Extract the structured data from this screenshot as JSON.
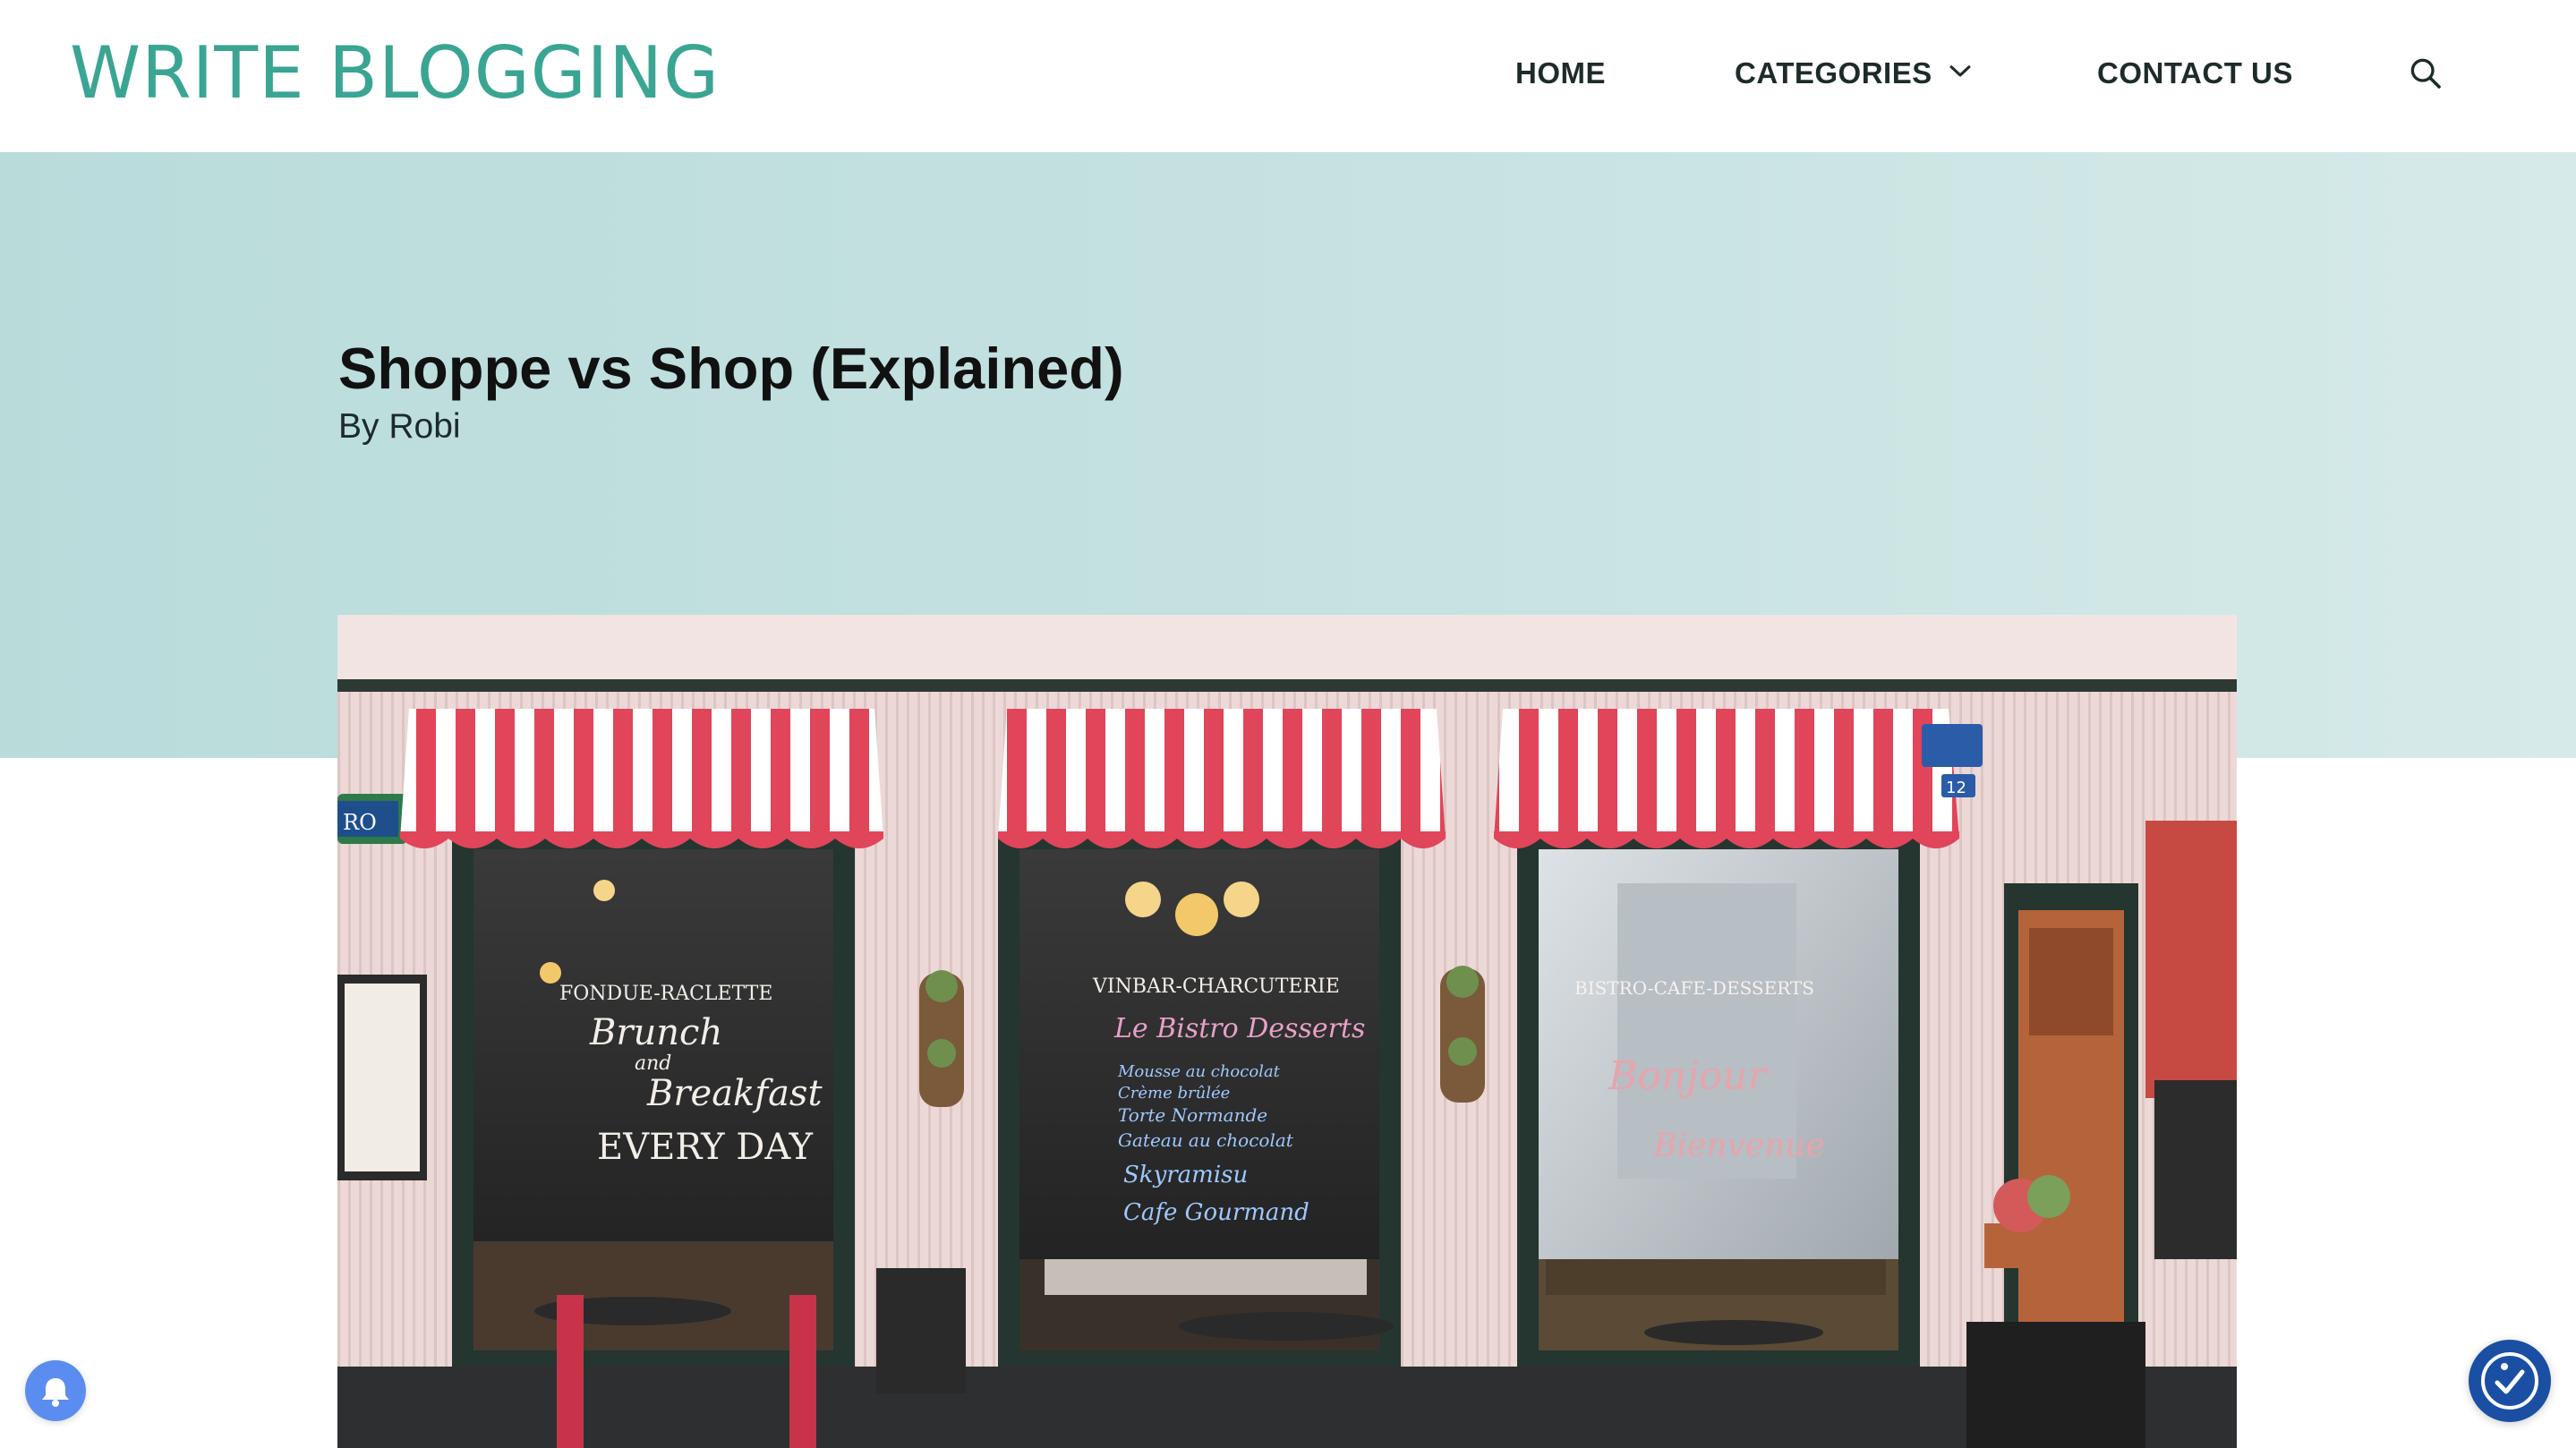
{
  "site": {
    "logo_text": "WRITE BLOGGING"
  },
  "nav": {
    "items": [
      {
        "label": "HOME"
      },
      {
        "label": "CATEGORIES"
      },
      {
        "label": "CONTACT US"
      }
    ],
    "icons": {
      "dropdown": "chevron-down-icon",
      "search": "search-icon"
    }
  },
  "post": {
    "title": "Shoppe vs Shop (Explained)",
    "byline": "By Robi"
  },
  "featured_image": {
    "storefront_signs": {
      "left_board": {
        "line1": "FONDUE-RACLETTE",
        "line2": "Brunch",
        "line3": "and",
        "line4": "Breakfast",
        "line5": "EVERY DAY"
      },
      "middle_board": {
        "line1": "VINBAR-CHARCUTERIE",
        "line2": "Le Bistro Desserts",
        "line3": "Mousse au chocolat",
        "line4": "Crème brûlée",
        "line5": "Torte Normande",
        "line6": "Gateau au chocolat",
        "line7": "Skyramisu",
        "line8": "Cafe Gourmand"
      },
      "right_board": {
        "line1": "BISTRO-CAFE-DESSERTS",
        "line2": "Bonjour",
        "line3": "Bienvenue"
      },
      "street_sign": "RO",
      "house_number": "12"
    }
  },
  "colors": {
    "brand": "#3aa593",
    "hero_bg": "#c6e2e1",
    "awning_red": "#e0455a",
    "bell_button": "#5b8df0",
    "accessibility_button": "#1a4fa3"
  },
  "widgets": {
    "notification": "bell-icon",
    "accessibility": "accessibility-icon"
  }
}
